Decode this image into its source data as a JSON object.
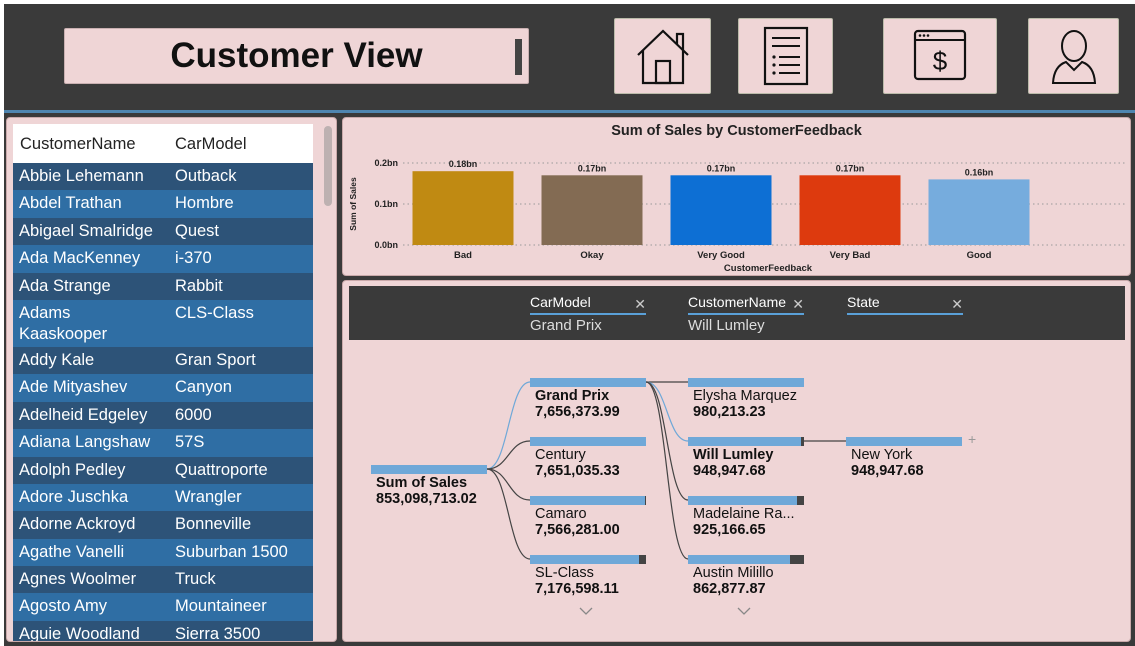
{
  "header": {
    "title": "Customer View",
    "nav": [
      "home-icon",
      "report-list-icon",
      "billing-dollar-icon",
      "user-profile-icon"
    ]
  },
  "table": {
    "columns": [
      "CustomerName",
      "CarModel"
    ],
    "rows": [
      [
        "Abbie Lehemann",
        "Outback"
      ],
      [
        "Abdel Trathan",
        "Hombre"
      ],
      [
        "Abigael Smalridge",
        "Quest"
      ],
      [
        "Ada MacKenney",
        "i-370"
      ],
      [
        "Ada Strange",
        "Rabbit"
      ],
      [
        "Adams Kaaskooper",
        "CLS-Class"
      ],
      [
        "Addy Kale",
        "Gran Sport"
      ],
      [
        "Ade Mityashev",
        "Canyon"
      ],
      [
        "Adelheid Edgeley",
        "6000"
      ],
      [
        "Adiana Langshaw",
        "57S"
      ],
      [
        "Adolph Pedley",
        "Quattroporte"
      ],
      [
        "Adore Juschka",
        "Wrangler"
      ],
      [
        "Adorne Ackroyd",
        "Bonneville"
      ],
      [
        "Agathe Vanelli",
        "Suburban 1500"
      ],
      [
        "Agnes Woolmer",
        "Truck"
      ],
      [
        "Agosto Amy",
        "Mountaineer"
      ],
      [
        "Aguie Woodland",
        "Sierra 3500"
      ]
    ]
  },
  "chart_data": {
    "type": "bar",
    "title": "Sum of Sales by CustomerFeedback",
    "xlabel": "CustomerFeedback",
    "ylabel": "Sum of Sales",
    "categories": [
      "Bad",
      "Okay",
      "Very Good",
      "Very Bad",
      "Good"
    ],
    "values": [
      0.18,
      0.17,
      0.17,
      0.17,
      0.16
    ],
    "data_labels": [
      "0.18bn",
      "0.17bn",
      "0.17bn",
      "0.17bn",
      "0.16bn"
    ],
    "colors": [
      "#c08a12",
      "#836b53",
      "#0d6fd4",
      "#dd3a0e",
      "#76acdd"
    ],
    "y_ticks": [
      "0.0bn",
      "0.1bn",
      "0.2bn"
    ],
    "ylim": [
      0,
      0.2
    ],
    "grid": true
  },
  "tree": {
    "filters": [
      {
        "field": "CarModel",
        "value": "Grand Prix"
      },
      {
        "field": "CustomerName",
        "value": "Will Lumley"
      },
      {
        "field": "State",
        "value": ""
      }
    ],
    "root": {
      "label": "Sum of Sales",
      "value": "853,098,713.02"
    },
    "level1": [
      {
        "label": "Grand Prix",
        "value": "7,656,373.99",
        "selected": true,
        "share": 1.0
      },
      {
        "label": "Century",
        "value": "7,651,035.33",
        "selected": false,
        "share": 1.0
      },
      {
        "label": "Camaro",
        "value": "7,566,281.00",
        "selected": false,
        "share": 0.99
      },
      {
        "label": "SL-Class",
        "value": "7,176,598.11",
        "selected": false,
        "share": 0.94
      }
    ],
    "level2": [
      {
        "label": "Elysha Marquez",
        "value": "980,213.23",
        "selected": false,
        "share": 1.0
      },
      {
        "label": "Will Lumley",
        "value": "948,947.68",
        "selected": true,
        "share": 0.97
      },
      {
        "label": "Madelaine Ra...",
        "value": "925,166.65",
        "selected": false,
        "share": 0.94
      },
      {
        "label": "Austin Milillo",
        "value": "862,877.87",
        "selected": false,
        "share": 0.88
      }
    ],
    "level3": [
      {
        "label": "New York",
        "value": "948,947.68",
        "selected": false,
        "share": 1.0
      }
    ],
    "expand_symbol": "+"
  }
}
